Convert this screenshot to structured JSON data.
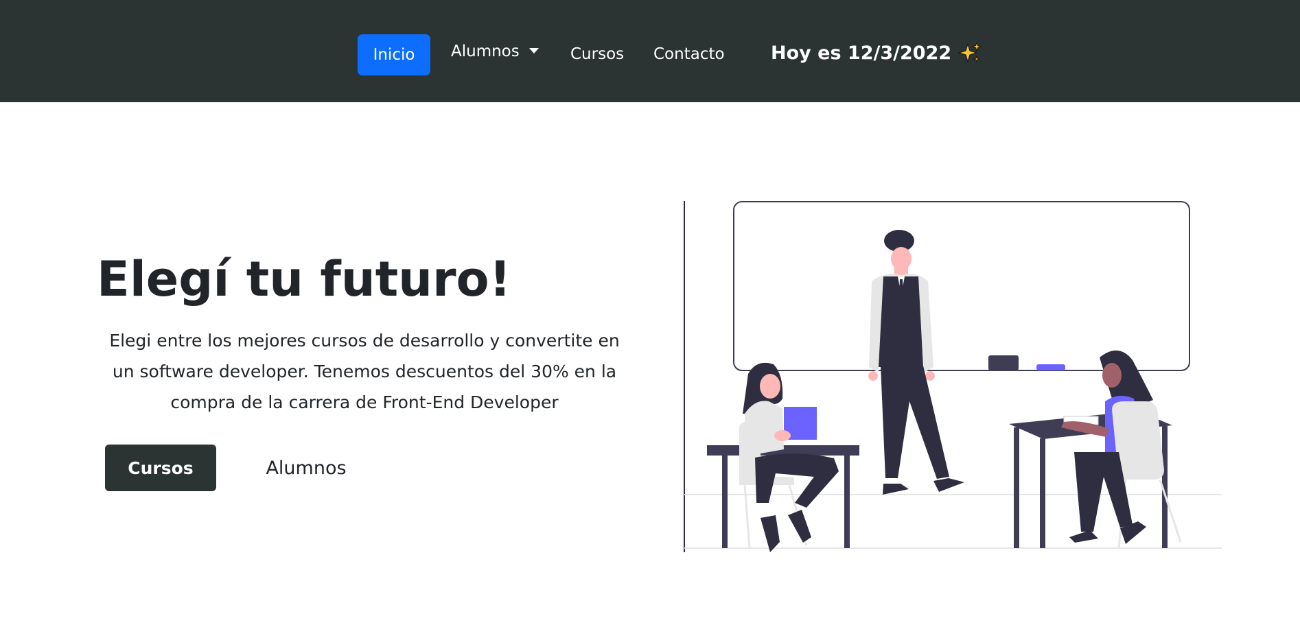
{
  "navbar": {
    "items": [
      {
        "label": "Inicio",
        "active": true
      },
      {
        "label": "Alumnos",
        "dropdown": true
      },
      {
        "label": "Cursos"
      },
      {
        "label": "Contacto"
      }
    ],
    "date_text": "Hoy es 12/3/2022",
    "date_icon": "sparkles-icon"
  },
  "hero": {
    "title": "Elegí tu futuro!",
    "description": "Elegi entre los mejores cursos de desarrollo y convertite en un software developer. Tenemos descuentos del 30% en la compra de la carrera de Front-End Developer",
    "buttons": {
      "primary": "Cursos",
      "secondary": "Alumnos"
    },
    "illustration": "classroom-illustration"
  },
  "colors": {
    "navbar_bg": "#2c3333",
    "active_nav": "#0d6efd",
    "accent_purple": "#6c63ff",
    "text_dark": "#212529"
  }
}
